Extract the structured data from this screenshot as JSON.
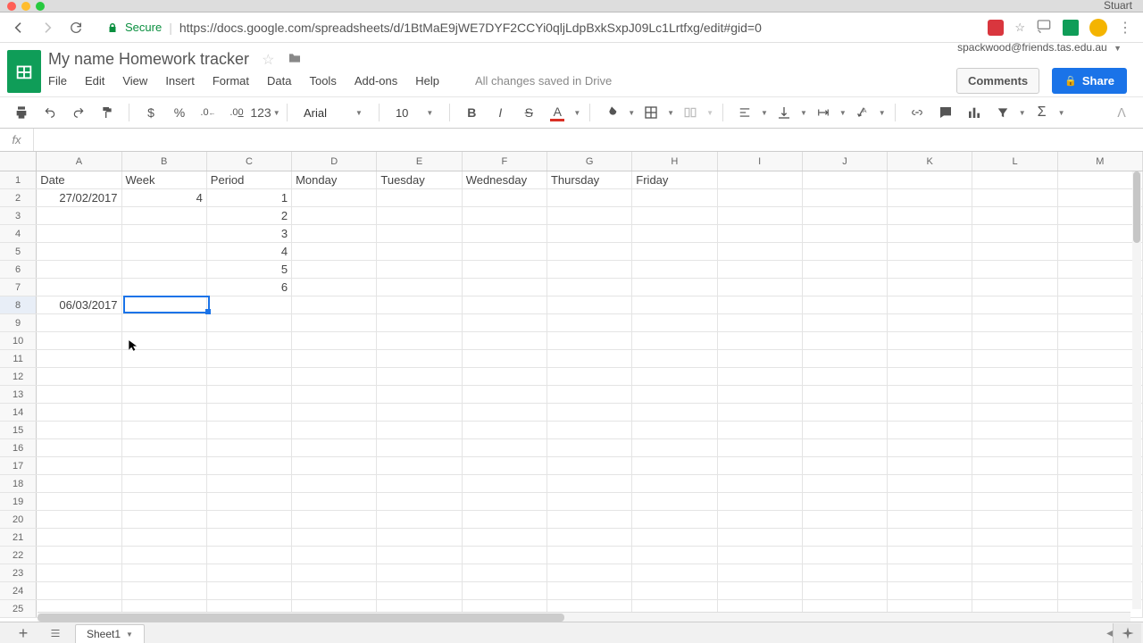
{
  "browser": {
    "user": "Stuart",
    "secure_label": "Secure",
    "url": "https://docs.google.com/spreadsheets/d/1BtMaE9jWE7DYF2CCYi0qljLdpBxkSxpJ09Lc1Lrtfxg/edit#gid=0"
  },
  "doc": {
    "title": "My name Homework tracker",
    "account": "spackwood@friends.tas.edu.au",
    "save_status": "All changes saved in Drive",
    "comments_label": "Comments",
    "share_label": "Share"
  },
  "menu": {
    "file": "File",
    "edit": "Edit",
    "view": "View",
    "insert": "Insert",
    "format": "Format",
    "data": "Data",
    "tools": "Tools",
    "addons": "Add-ons",
    "help": "Help"
  },
  "toolbar": {
    "currency": "$",
    "percent": "%",
    "dec_dec": ".0",
    "dec_inc": ".00",
    "format_123": "123",
    "font": "Arial",
    "font_size": "10",
    "bold": "B",
    "italic": "I",
    "strike": "S",
    "text_color": "A"
  },
  "formula": {
    "fx": "fx",
    "value": ""
  },
  "columns": [
    {
      "label": "A",
      "width": 97
    },
    {
      "label": "B",
      "width": 97
    },
    {
      "label": "C",
      "width": 97
    },
    {
      "label": "D",
      "width": 97
    },
    {
      "label": "E",
      "width": 97
    },
    {
      "label": "F",
      "width": 97
    },
    {
      "label": "G",
      "width": 97
    },
    {
      "label": "H",
      "width": 97
    },
    {
      "label": "I",
      "width": 97
    },
    {
      "label": "J",
      "width": 97
    },
    {
      "label": "K",
      "width": 97
    },
    {
      "label": "L",
      "width": 97
    },
    {
      "label": "M",
      "width": 97
    }
  ],
  "rows": [
    {
      "n": 1,
      "cells": [
        "Date",
        "Week",
        "Period",
        "Monday",
        "Tuesday",
        "Wednesday",
        "Thursday",
        "Friday",
        "",
        "",
        "",
        "",
        ""
      ],
      "align": [
        "l",
        "l",
        "l",
        "l",
        "l",
        "l",
        "l",
        "l",
        "l",
        "l",
        "l",
        "l",
        "l"
      ]
    },
    {
      "n": 2,
      "cells": [
        "27/02/2017",
        "4",
        "1",
        "",
        "",
        "",
        "",
        "",
        "",
        "",
        "",
        "",
        ""
      ],
      "align": [
        "r",
        "r",
        "r",
        "l",
        "l",
        "l",
        "l",
        "l",
        "l",
        "l",
        "l",
        "l",
        "l"
      ]
    },
    {
      "n": 3,
      "cells": [
        "",
        "",
        "2",
        "",
        "",
        "",
        "",
        "",
        "",
        "",
        "",
        "",
        ""
      ],
      "align": [
        "l",
        "l",
        "r",
        "l",
        "l",
        "l",
        "l",
        "l",
        "l",
        "l",
        "l",
        "l",
        "l"
      ]
    },
    {
      "n": 4,
      "cells": [
        "",
        "",
        "3",
        "",
        "",
        "",
        "",
        "",
        "",
        "",
        "",
        "",
        ""
      ],
      "align": [
        "l",
        "l",
        "r",
        "l",
        "l",
        "l",
        "l",
        "l",
        "l",
        "l",
        "l",
        "l",
        "l"
      ]
    },
    {
      "n": 5,
      "cells": [
        "",
        "",
        "4",
        "",
        "",
        "",
        "",
        "",
        "",
        "",
        "",
        "",
        ""
      ],
      "align": [
        "l",
        "l",
        "r",
        "l",
        "l",
        "l",
        "l",
        "l",
        "l",
        "l",
        "l",
        "l",
        "l"
      ]
    },
    {
      "n": 6,
      "cells": [
        "",
        "",
        "5",
        "",
        "",
        "",
        "",
        "",
        "",
        "",
        "",
        "",
        ""
      ],
      "align": [
        "l",
        "l",
        "r",
        "l",
        "l",
        "l",
        "l",
        "l",
        "l",
        "l",
        "l",
        "l",
        "l"
      ]
    },
    {
      "n": 7,
      "cells": [
        "",
        "",
        "6",
        "",
        "",
        "",
        "",
        "",
        "",
        "",
        "",
        "",
        ""
      ],
      "align": [
        "l",
        "l",
        "r",
        "l",
        "l",
        "l",
        "l",
        "l",
        "l",
        "l",
        "l",
        "l",
        "l"
      ]
    },
    {
      "n": 8,
      "cells": [
        "06/03/2017",
        "",
        "",
        "",
        "",
        "",
        "",
        "",
        "",
        "",
        "",
        "",
        ""
      ],
      "align": [
        "r",
        "l",
        "l",
        "l",
        "l",
        "l",
        "l",
        "l",
        "l",
        "l",
        "l",
        "l",
        "l"
      ]
    },
    {
      "n": 9,
      "cells": [
        "",
        "",
        "",
        "",
        "",
        "",
        "",
        "",
        "",
        "",
        "",
        "",
        ""
      ],
      "align": []
    },
    {
      "n": 10,
      "cells": [
        "",
        "",
        "",
        "",
        "",
        "",
        "",
        "",
        "",
        "",
        "",
        "",
        ""
      ],
      "align": []
    },
    {
      "n": 11,
      "cells": [
        "",
        "",
        "",
        "",
        "",
        "",
        "",
        "",
        "",
        "",
        "",
        "",
        ""
      ],
      "align": []
    },
    {
      "n": 12,
      "cells": [
        "",
        "",
        "",
        "",
        "",
        "",
        "",
        "",
        "",
        "",
        "",
        "",
        ""
      ],
      "align": []
    },
    {
      "n": 13,
      "cells": [
        "",
        "",
        "",
        "",
        "",
        "",
        "",
        "",
        "",
        "",
        "",
        "",
        ""
      ],
      "align": []
    },
    {
      "n": 14,
      "cells": [
        "",
        "",
        "",
        "",
        "",
        "",
        "",
        "",
        "",
        "",
        "",
        "",
        ""
      ],
      "align": []
    },
    {
      "n": 15,
      "cells": [
        "",
        "",
        "",
        "",
        "",
        "",
        "",
        "",
        "",
        "",
        "",
        "",
        ""
      ],
      "align": []
    },
    {
      "n": 16,
      "cells": [
        "",
        "",
        "",
        "",
        "",
        "",
        "",
        "",
        "",
        "",
        "",
        "",
        ""
      ],
      "align": []
    },
    {
      "n": 17,
      "cells": [
        "",
        "",
        "",
        "",
        "",
        "",
        "",
        "",
        "",
        "",
        "",
        "",
        ""
      ],
      "align": []
    },
    {
      "n": 18,
      "cells": [
        "",
        "",
        "",
        "",
        "",
        "",
        "",
        "",
        "",
        "",
        "",
        "",
        ""
      ],
      "align": []
    },
    {
      "n": 19,
      "cells": [
        "",
        "",
        "",
        "",
        "",
        "",
        "",
        "",
        "",
        "",
        "",
        "",
        ""
      ],
      "align": []
    },
    {
      "n": 20,
      "cells": [
        "",
        "",
        "",
        "",
        "",
        "",
        "",
        "",
        "",
        "",
        "",
        "",
        ""
      ],
      "align": []
    },
    {
      "n": 21,
      "cells": [
        "",
        "",
        "",
        "",
        "",
        "",
        "",
        "",
        "",
        "",
        "",
        "",
        ""
      ],
      "align": []
    },
    {
      "n": 22,
      "cells": [
        "",
        "",
        "",
        "",
        "",
        "",
        "",
        "",
        "",
        "",
        "",
        "",
        ""
      ],
      "align": []
    },
    {
      "n": 23,
      "cells": [
        "",
        "",
        "",
        "",
        "",
        "",
        "",
        "",
        "",
        "",
        "",
        "",
        ""
      ],
      "align": []
    },
    {
      "n": 24,
      "cells": [
        "",
        "",
        "",
        "",
        "",
        "",
        "",
        "",
        "",
        "",
        "",
        "",
        ""
      ],
      "align": []
    },
    {
      "n": 25,
      "cells": [
        "",
        "",
        "",
        "",
        "",
        "",
        "",
        "",
        "",
        "",
        "",
        "",
        ""
      ],
      "align": []
    }
  ],
  "selection": {
    "row": 8,
    "col": 1
  },
  "sheet_tabs": {
    "active": "Sheet1"
  }
}
